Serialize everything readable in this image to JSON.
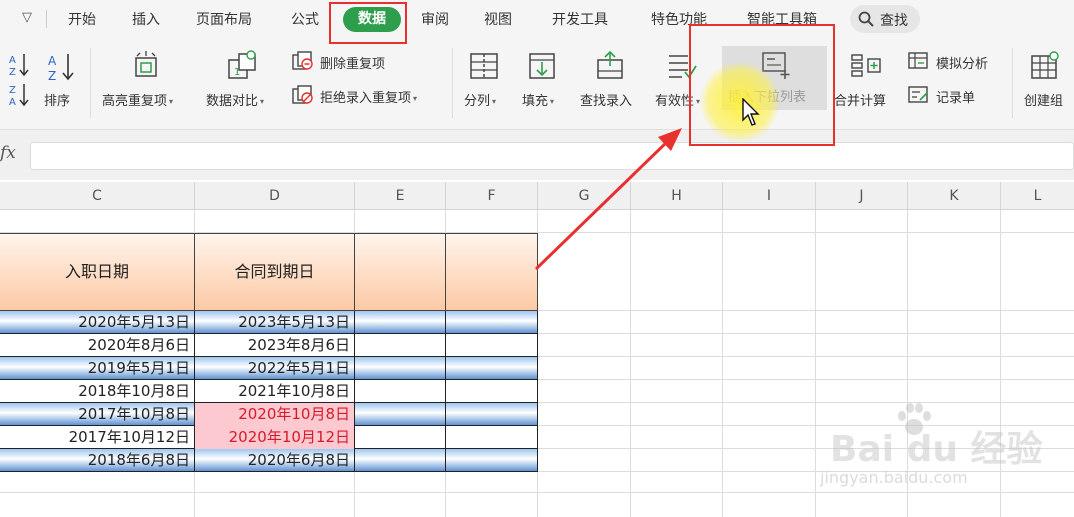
{
  "menu": {
    "caret": "▽",
    "tabs": [
      "开始",
      "插入",
      "页面布局",
      "公式",
      "数据",
      "审阅",
      "视图",
      "开发工具",
      "特色功能",
      "智能工具箱"
    ],
    "active_tab": "数据",
    "search_label": "查找"
  },
  "ribbon": {
    "sort_asc_label": "",
    "sort_label": "排序",
    "highlight_dup_label": "高亮重复项",
    "compare_label": "数据对比",
    "delete_dup_label": "删除重复项",
    "reject_dup_label": "拒绝录入重复项",
    "split_label": "分列",
    "fill_label": "填充",
    "lookup_entry_label": "查找录入",
    "validity_label": "有效性",
    "insert_dropdown_label": "插入下拉列表",
    "merge_calc_label": "合并计算",
    "simulate_label": "模拟分析",
    "record_label": "记录单",
    "create_group_label": "创建组"
  },
  "formula_bar": {
    "fx": "fx",
    "value": ""
  },
  "sheet": {
    "columns": [
      "C",
      "D",
      "E",
      "F",
      "G",
      "H",
      "I",
      "J",
      "K",
      "L"
    ],
    "header": {
      "c": "入职日期",
      "d": "合同到期日"
    },
    "rows": [
      {
        "c": "2020年5月13日",
        "d": "2023年5月13日",
        "style": "blue",
        "highlight_d": false
      },
      {
        "c": "2020年8月6日",
        "d": "2023年8月6日",
        "style": "white",
        "highlight_d": false
      },
      {
        "c": "2019年5月1日",
        "d": "2022年5月1日",
        "style": "blue",
        "highlight_d": false
      },
      {
        "c": "2018年10月8日",
        "d": "2021年10月8日",
        "style": "white",
        "highlight_d": false
      },
      {
        "c": "2017年10月8日",
        "d": "2020年10月8日",
        "style": "blue",
        "highlight_d": true
      },
      {
        "c": "2017年10月12日",
        "d": "2020年10月12日",
        "style": "white",
        "highlight_d": true
      },
      {
        "c": "2018年6月8日",
        "d": "2020年6月8日",
        "style": "blue",
        "highlight_d": false
      }
    ]
  },
  "watermark": {
    "main": "Bai du 经验",
    "sub": "jingyan.baidu.com"
  },
  "colors": {
    "accent_green": "#2e9e4d",
    "annotation_red": "#e8302e",
    "highlight_pink": "#fbc9cf",
    "highlight_text": "#d41b2a"
  }
}
